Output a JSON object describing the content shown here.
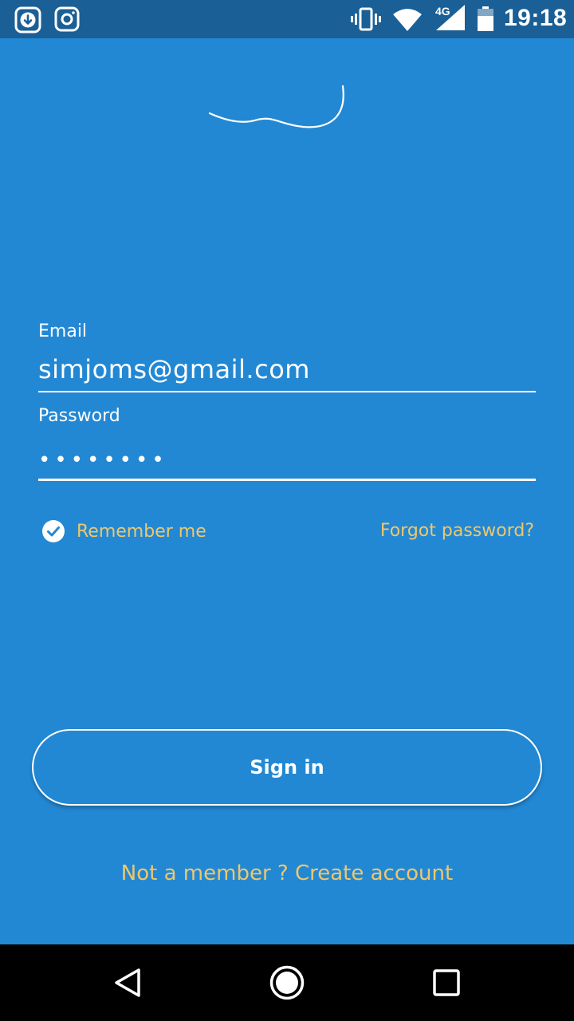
{
  "status_bar": {
    "time": "19:18",
    "network_type": "4G",
    "icons": [
      "download-icon",
      "instagram-icon",
      "vibrate-icon",
      "wifi-icon",
      "signal-icon",
      "battery-icon"
    ]
  },
  "login": {
    "email_label": "Email",
    "email_value": "simjoms@gmail.com",
    "password_label": "Password",
    "password_masked": "••••••••",
    "remember_label": "Remember me",
    "remember_checked": true,
    "forgot_label": "Forgot password?",
    "signin_label": "Sign in",
    "create_account_label": "Not a member ? Create account"
  },
  "colors": {
    "background": "#2388d4",
    "status_bar": "#1a5f95",
    "accent_text": "#eec76b",
    "text": "#ffffff",
    "nav_bar": "#000000"
  },
  "nav_bar": {
    "icons": [
      "back-icon",
      "home-icon",
      "recent-apps-icon"
    ]
  }
}
